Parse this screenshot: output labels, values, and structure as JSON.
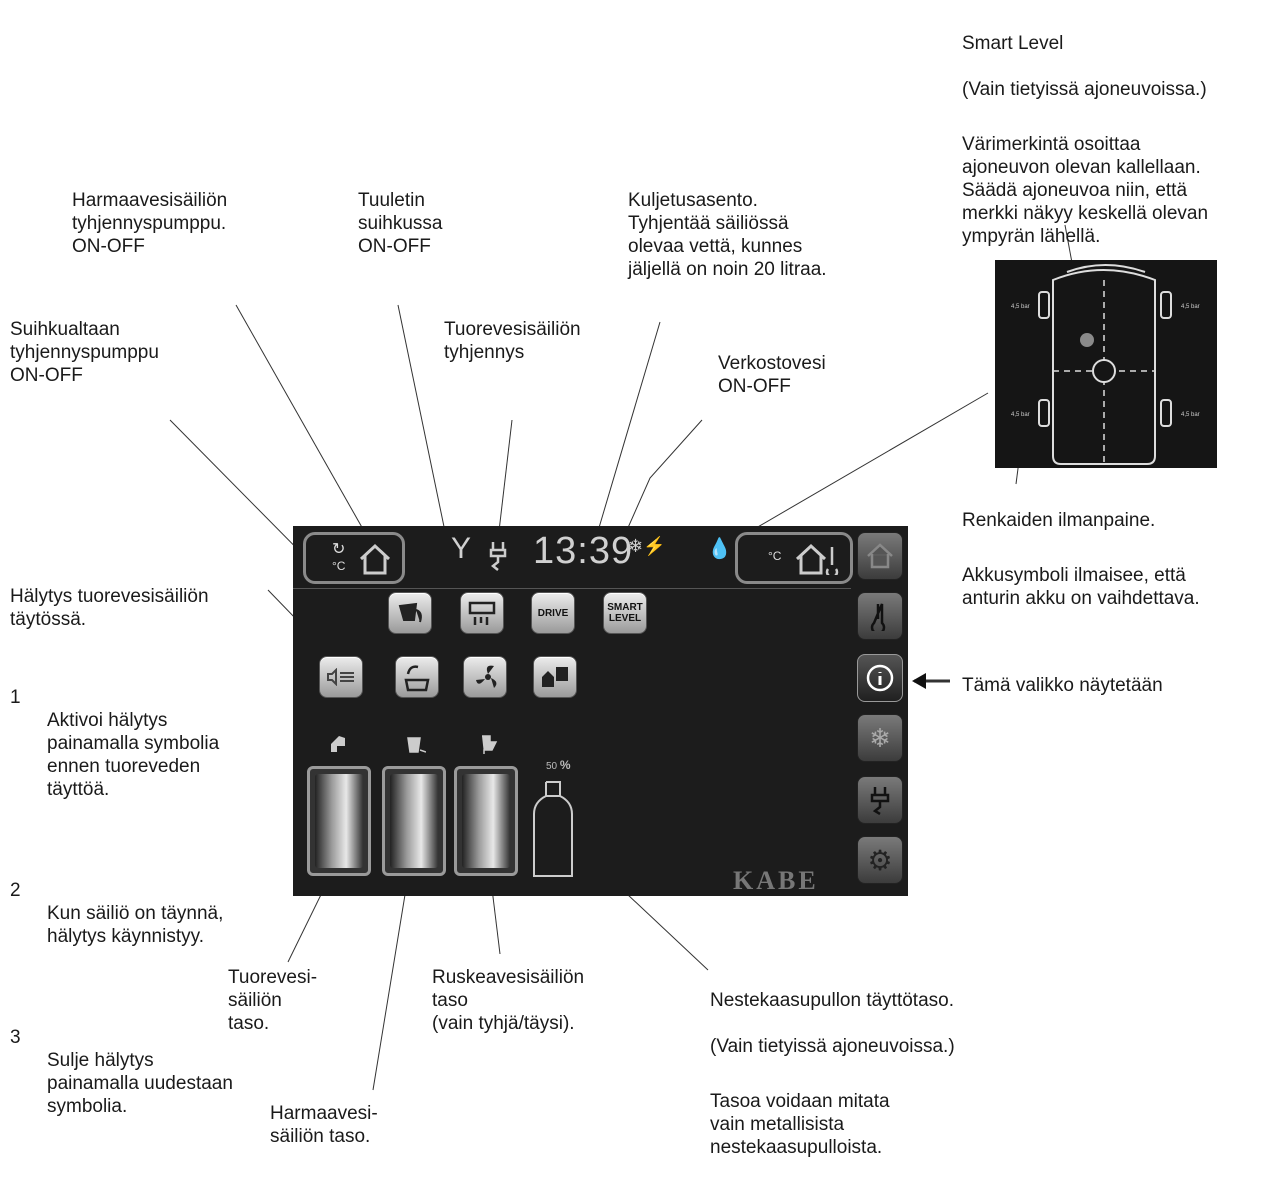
{
  "callouts": {
    "smart_level": {
      "title": "Smart Level",
      "subtitle": "(Vain tietyissä ajoneuvoissa.)",
      "description": "Värimerkintä osoittaa\najoneuvon olevan kallellaan.\nSäädä ajoneuvoa niin, että\nmerkki näkyy keskellä olevan\nympyrän lähellä."
    },
    "grey_pump": "Harmaavesisäiliön\ntyhjennyspumppu.\nON-OFF",
    "shower_fan": "Tuuletin\nsuihkussa\nON-OFF",
    "transport": "Kuljetusasento.\nTyhjentää säiliössä\nolevaa vettä, kunnes\njäljellä on noin 20 litraa.",
    "shower_pump": "Suihkualtaan\ntyhjennyspumppu\nON-OFF",
    "fresh_drain": "Tuorevesisäiliön\ntyhjennys",
    "mains_water": "Verkostovesi\nON-OFF",
    "tyres": {
      "title": "Renkaiden ilmanpaine.",
      "description": "Akkusymboli ilmaisee, että\nanturin akku on vaihdettava."
    },
    "alarm": {
      "title": "Hälytys tuorevesisäiliön\ntäytössä.",
      "steps": [
        {
          "num": "1",
          "text": "Aktivoi hälytys\npainamalla symbolia\nennen tuoreveden\ntäyttöä."
        },
        {
          "num": "2",
          "text": "Kun säiliö on täynnä,\nhälytys käynnistyy."
        },
        {
          "num": "3",
          "text": "Sulje hälytys\npainamalla uudestaan\nsymbolia."
        }
      ]
    },
    "menu_shown": "Tämä valikko näytetään",
    "fresh_level": "Tuorevesi-\nsäiliön\ntaso.",
    "brown_level": "Ruskeavesisäiliön\ntaso\n(vain tyhjä/täysi).",
    "grey_level": "Harmaavesi-\nsäiliön taso.",
    "gas_level": {
      "title": "Nestekaasupullon täyttötaso.",
      "subtitle": "(Vain tietyissä ajoneuvoissa.)",
      "description": "Tasoa voidaan mitata\nvain metallisista\nnestekaasupulloista."
    }
  },
  "panel": {
    "clock": "13:39",
    "temp_unit": "°C",
    "buttons": {
      "drive_label": "DRIVE",
      "smart_level_label": "SMART\nLEVEL"
    },
    "gas_percent": "50",
    "gas_percent_unit": "%",
    "brand": "KABE"
  },
  "inset": {
    "pressure_labels": [
      "4,5 bar",
      "4,5 bar",
      "4,5 bar",
      "4,5 bar"
    ]
  },
  "colors": {
    "panel_bg": "#1c1c1c",
    "leader": "#333333",
    "tilt_marker": "#8a8a8a"
  }
}
